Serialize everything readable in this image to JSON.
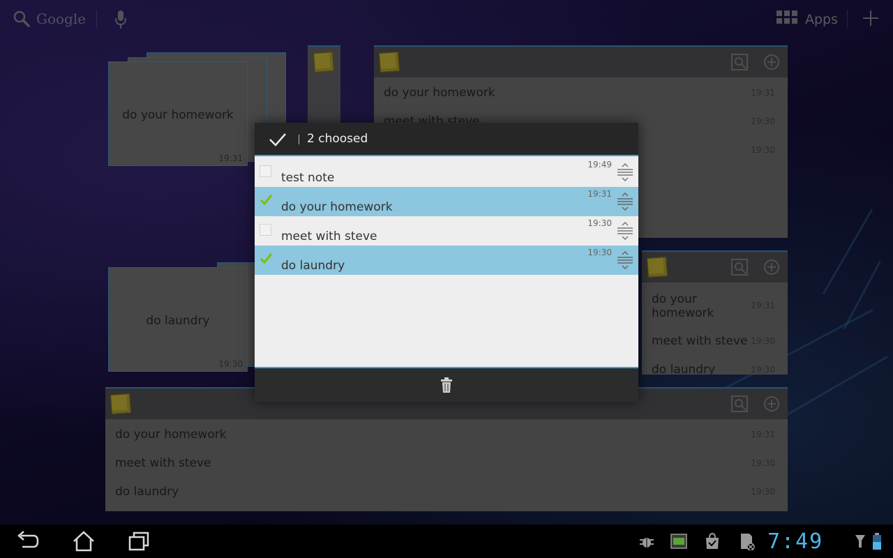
{
  "topbar": {
    "search_label": "Google",
    "apps_label": "Apps"
  },
  "stickies": [
    {
      "text": "do your homework",
      "time": "19:31"
    },
    {
      "text": "do laundry",
      "time": "19:30"
    }
  ],
  "widget_top_right": {
    "rows": [
      {
        "text": "do your homework",
        "time": "19:31"
      },
      {
        "text": "meet with steve",
        "time": "19:30"
      },
      {
        "text": "",
        "time": "19:30"
      }
    ]
  },
  "widget_mid_right": {
    "rows": [
      {
        "text": "do your homework",
        "time": "19:31"
      },
      {
        "text": "meet with steve",
        "time": "19:30"
      },
      {
        "text": "do laundry",
        "time": "19:30"
      }
    ]
  },
  "widget_bottom": {
    "rows": [
      {
        "text": "do your homework",
        "time": "19:31"
      },
      {
        "text": "meet with steve",
        "time": "19:30"
      },
      {
        "text": "do laundry",
        "time": "19:30"
      }
    ]
  },
  "dialog": {
    "title": "2 choosed",
    "items": [
      {
        "text": "test note",
        "time": "19:49",
        "checked": false
      },
      {
        "text": "do your homework",
        "time": "19:31",
        "checked": true
      },
      {
        "text": "meet with steve",
        "time": "19:30",
        "checked": false
      },
      {
        "text": "do laundry",
        "time": "19:30",
        "checked": true
      }
    ]
  },
  "systembar": {
    "clock": "7:49"
  },
  "colors": {
    "accent": "#33a5de",
    "selected_row": "#8cc6df",
    "check_green": "#7cc000",
    "note_yellow": "#d4c23a",
    "clock": "#4fb6e8"
  }
}
